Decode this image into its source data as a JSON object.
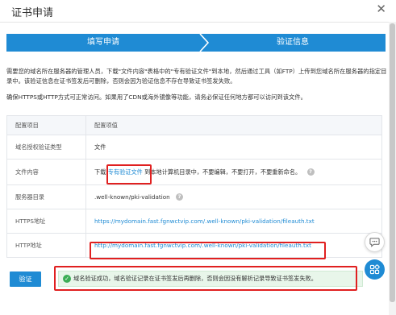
{
  "dialog": {
    "title": "证书申请",
    "close_label": "✕"
  },
  "steps": [
    {
      "label": "填写申请"
    },
    {
      "label": "验证信息"
    }
  ],
  "description": {
    "para1": "需要您的域名所在服务器的管理人员，下载\"文件内容\"表格中的\"专有验证文件\"到本地，然后通过工具（如FTP）上传到您域名所在服务器的指定目录中。该验证信息在证书签发后可删除，否则会因为验证信息不存在导致证书签发失败。",
    "para2": "确保HTTPS或HTTP方式可正常访问。如果用了CDN或海外镜像等功能，请务必保证任何地方都可以访问到该文件。"
  },
  "table": {
    "headers": [
      "配置项目",
      "配置项值"
    ],
    "rows": [
      {
        "label": "域名授权验证类型",
        "value": "文件"
      },
      {
        "label": "文件内容",
        "prefix": "下载",
        "link": "专有验证文件",
        "suffix": "到本地计算机目录中，不要编辑，不要打开，不要重新命名。"
      },
      {
        "label": "服务器目录",
        "value": ".well-known/pki-validation"
      },
      {
        "label": "HTTPS地址",
        "link": "https://mydomain.fast.fgnwctvip.com/.well-known/pki-validation/fileauth.txt"
      },
      {
        "label": "HTTP地址",
        "link": "http://mydomain.fast.fgnwctvip.com/.well-known/pki-validation/fileauth.txt"
      }
    ]
  },
  "footer": {
    "verify_label": "验证",
    "success_message": "域名验证成功，域名验证记录在证书签发后再删除，否则会因没有解析记录导致证书签发失败。"
  },
  "icons": {
    "help": "help-circle-icon",
    "success": "check-circle-icon",
    "chat": "chat-icon",
    "apps": "apps-icon"
  },
  "colors": {
    "primary": "#1f8bd4",
    "success": "#3cae56",
    "highlight_box": "#e02020"
  }
}
